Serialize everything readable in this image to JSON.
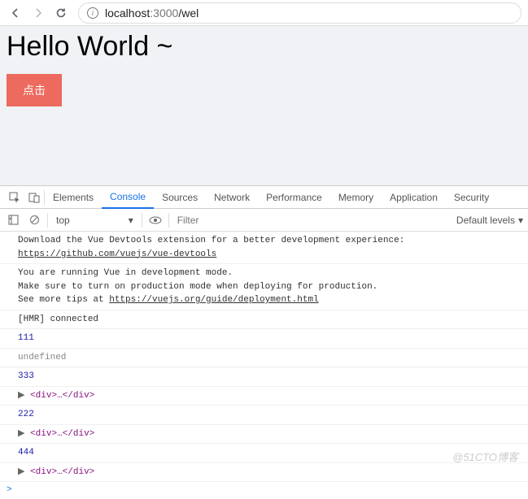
{
  "url": {
    "host": "localhost",
    "port": ":3000",
    "path": "/wel"
  },
  "page": {
    "heading": "Hello World ~",
    "button_label": "点击"
  },
  "devtools": {
    "tabs": [
      "Elements",
      "Console",
      "Sources",
      "Network",
      "Performance",
      "Memory",
      "Application",
      "Security"
    ],
    "active_tab": "Console",
    "context": "top",
    "filter_placeholder": "Filter",
    "levels_label": "Default levels",
    "logs": [
      {
        "type": "text",
        "lines": [
          "Download the Vue Devtools extension for a better development experience:"
        ],
        "link": "https://github.com/vuejs/vue-devtools"
      },
      {
        "type": "text",
        "lines": [
          "You are running Vue in development mode.",
          "Make sure to turn on production mode when deploying for production."
        ],
        "trailing": "See more tips at ",
        "link": "https://vuejs.org/guide/deployment.html"
      },
      {
        "type": "text",
        "lines": [
          "[HMR] connected"
        ]
      },
      {
        "type": "number",
        "value": "111"
      },
      {
        "type": "undefined",
        "value": "undefined"
      },
      {
        "type": "number",
        "value": "333"
      },
      {
        "type": "element",
        "value": "<div>…</div>"
      },
      {
        "type": "number",
        "value": "222"
      },
      {
        "type": "element",
        "value": "<div>…</div>"
      },
      {
        "type": "number",
        "value": "444"
      },
      {
        "type": "element",
        "value": "<div>…</div>"
      }
    ],
    "prompt": ">"
  },
  "watermark": "@51CTO博客"
}
